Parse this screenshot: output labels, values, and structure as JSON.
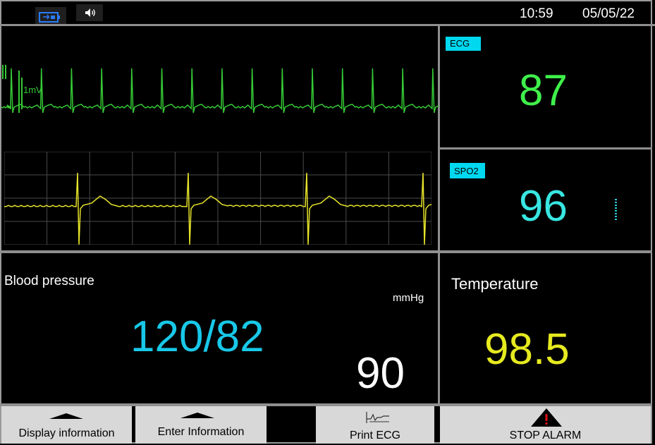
{
  "status_bar": {
    "battery_icon": "battery-charging-icon",
    "speaker_icon": "speaker-icon",
    "time": "10:59",
    "date": "05/05/22"
  },
  "ecg_trace": {
    "scale_label": "1mV",
    "color": "#35c935"
  },
  "secondary_trace": {
    "color": "#e6e32a"
  },
  "ecg": {
    "label": "ECG",
    "value": "87",
    "color": "#3ff04a"
  },
  "spo2": {
    "label": "SPO2",
    "value": "96",
    "color": "#38e6e2"
  },
  "blood_pressure": {
    "label": "Blood pressure",
    "unit": "mmHg",
    "value": "120/82",
    "pulse": "90"
  },
  "temperature": {
    "label": "Temperature",
    "value": "98.5"
  },
  "buttons": {
    "display_information": "Display information",
    "enter_information": "Enter Information",
    "print_ecg": "Print ECG",
    "stop_alarm": "STOP ALARM"
  }
}
